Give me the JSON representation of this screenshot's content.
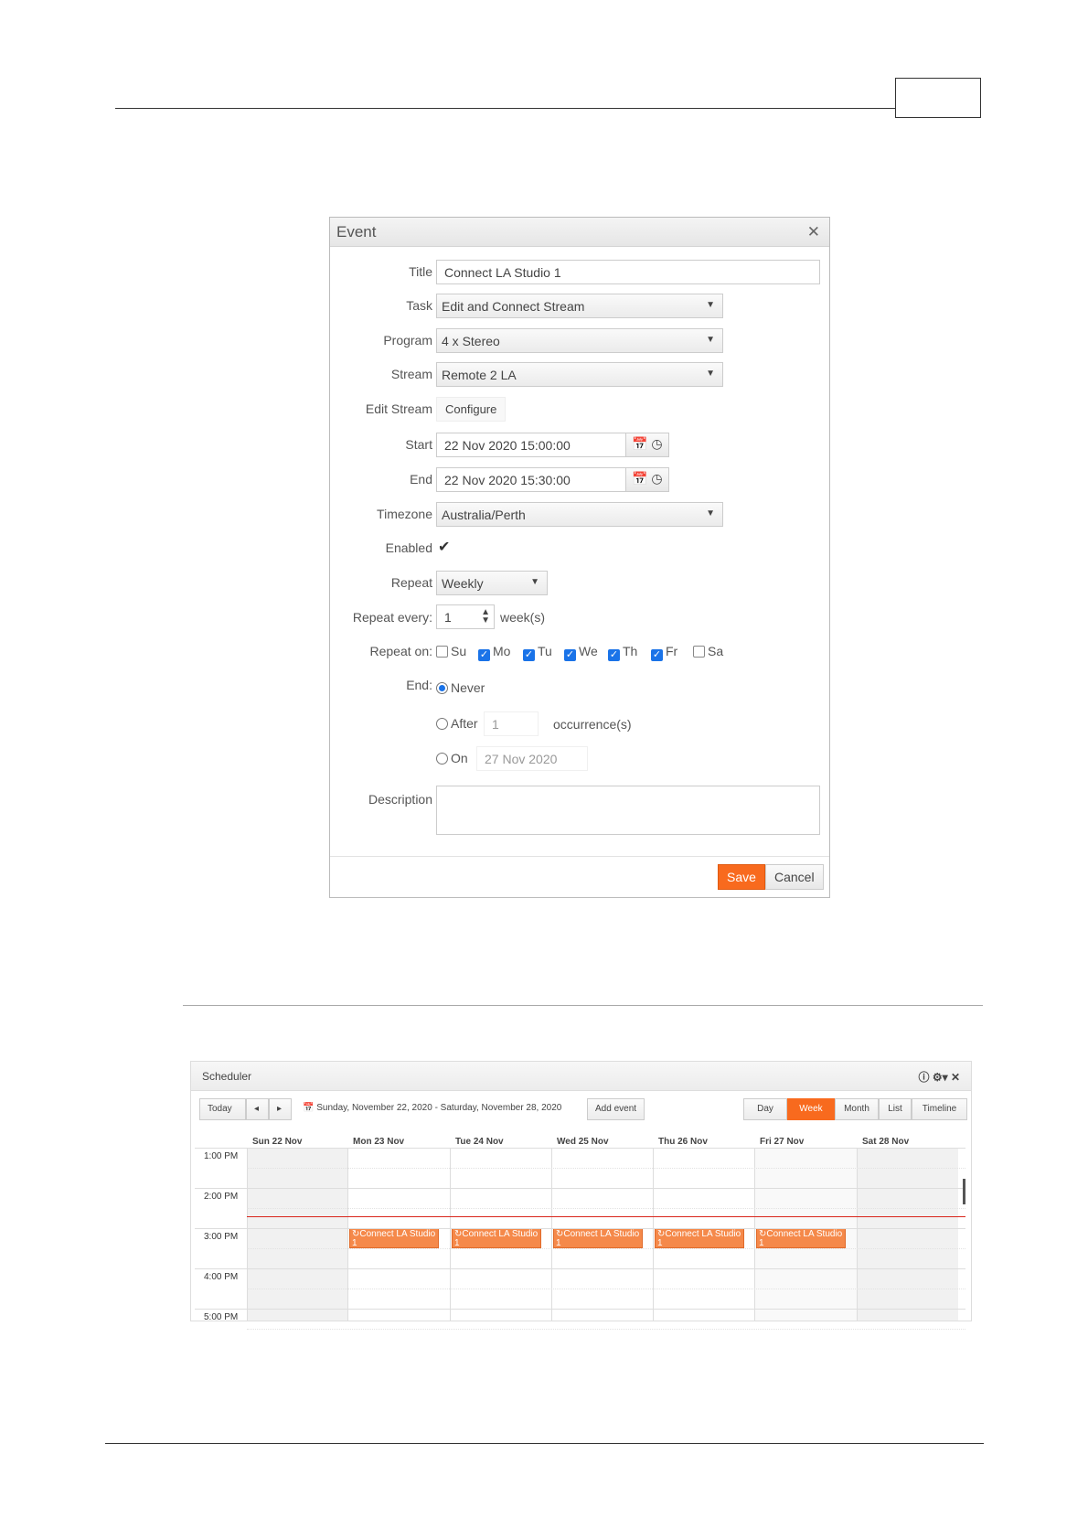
{
  "dialog": {
    "title": "Event",
    "close_icon": "close-icon",
    "fields": {
      "title_label": "Title",
      "title_value": "Connect LA Studio 1",
      "task_label": "Task",
      "task_value": "Edit and Connect Stream",
      "program_label": "Program",
      "program_value": "4 x Stereo",
      "stream_label": "Stream",
      "stream_value": "Remote 2 LA",
      "edit_stream_label": "Edit Stream",
      "configure_button": "Configure",
      "start_label": "Start",
      "start_value": "22 Nov 2020 15:00:00",
      "end_label": "End",
      "end_value": "22 Nov 2020 15:30:00",
      "timezone_label": "Timezone",
      "timezone_value": "Australia/Perth",
      "enabled_label": "Enabled",
      "enabled": true,
      "repeat_label": "Repeat",
      "repeat_value": "Weekly",
      "repeat_every_label": "Repeat every:",
      "repeat_every_value": "1",
      "repeat_every_unit": "week(s)",
      "repeat_on_label": "Repeat on:",
      "days": [
        {
          "label": "Su",
          "checked": false
        },
        {
          "label": "Mo",
          "checked": true
        },
        {
          "label": "Tu",
          "checked": true
        },
        {
          "label": "We",
          "checked": true
        },
        {
          "label": "Th",
          "checked": true
        },
        {
          "label": "Fr",
          "checked": true
        },
        {
          "label": "Sa",
          "checked": false
        }
      ],
      "end_option_label": "End:",
      "never_label": "Never",
      "after_label": "After",
      "after_value": "1",
      "occurrences_label": "occurrence(s)",
      "on_label": "On",
      "on_value": "27 Nov 2020",
      "end_selected": "Never",
      "description_label": "Description",
      "description_value": ""
    },
    "save_button": "Save",
    "cancel_button": "Cancel",
    "accent": "#f86a1e"
  },
  "scheduler": {
    "title": "Scheduler",
    "today": "Today",
    "date_range": "Sunday, November 22, 2020 - Saturday, November 28, 2020",
    "add_event": "Add event",
    "views": [
      "Day",
      "Week",
      "Month",
      "List",
      "Timeline"
    ],
    "active_view": "Week",
    "days": [
      "Sun 22 Nov",
      "Mon 23 Nov",
      "Tue 24 Nov",
      "Wed 25 Nov",
      "Thu 26 Nov",
      "Fri 27 Nov",
      "Sat 28 Nov"
    ],
    "times": [
      "1:00 PM",
      "2:00 PM",
      "3:00 PM",
      "4:00 PM",
      "5:00 PM"
    ],
    "event_title": "Connect LA Studio 1",
    "event_color": "#f5894a",
    "now_line_color": "#d9261c"
  }
}
